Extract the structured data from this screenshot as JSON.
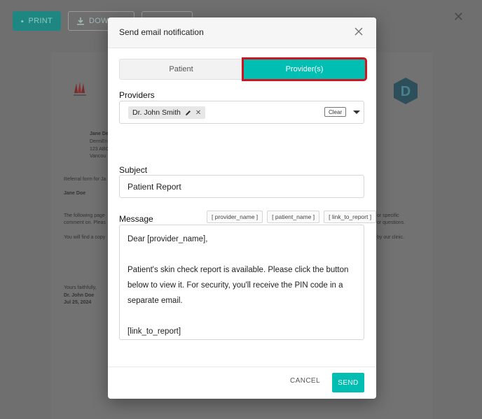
{
  "background": {
    "toolbar": {
      "print_label": "PRINT",
      "download_label": "DOWN"
    },
    "letter": {
      "sender_name": "Jane De",
      "sender_line2": "DermEn",
      "sender_line3": "123 ABC",
      "sender_line4": "Vancou",
      "referral_line": "Referral form for Ja",
      "patient_name": "Jane Doe",
      "body_line1_left": "The following page",
      "body_line1_right": "or specific",
      "body_line2_left": "comment on. Pleas",
      "body_line2_right": "or questions.",
      "body_line3_left": "You will find a copy",
      "body_line3_right": "by our clinic.",
      "closing": "Yours faithfully,",
      "signer": "Dr. John Doe",
      "date": "Jul 25, 2024"
    }
  },
  "modal": {
    "title": "Send email notification",
    "tabs": [
      {
        "label": "Patient",
        "selected": false
      },
      {
        "label": "Provider(s)",
        "selected": true
      }
    ],
    "providers": {
      "label": "Providers",
      "chips": [
        {
          "label": "Dr. John Smith"
        }
      ],
      "clear_label": "Clear"
    },
    "subject": {
      "label": "Subject",
      "value": "Patient Report"
    },
    "message": {
      "label": "Message",
      "tokens": [
        "[ provider_name ]",
        "[ patient_name ]",
        "[ link_to_report ]"
      ],
      "lines": [
        "Dear [provider_name],",
        "",
        "Patient's skin check report is available. Please click the button",
        "below to view it. For security, you'll receive the PIN code in a",
        "separate email.",
        "",
        "[link_to_report]"
      ]
    },
    "footer": {
      "cancel_label": "CANCEL",
      "send_label": "SEND"
    }
  },
  "colors": {
    "accent": "#00bfb2",
    "highlight": "#d0141f",
    "overlay": "#6f6f6f"
  }
}
